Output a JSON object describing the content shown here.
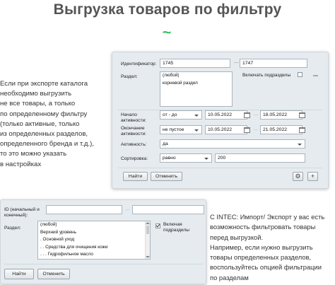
{
  "heading": "Выгрузка товаров по фильтру",
  "decor": "~",
  "left_text": "Если при экспорте каталога\nнеобходимо выгрузить\nне все товары, а только\nпо определенному фильтру\n(только активные, только\nиз определенных разделов,\nопределенного бренда и т.д.),\nто это можно указать\nв настройках",
  "right_text": "С INTEC: Импорт/ Экспорт у вас есть\nвозможность фильтровать товары\nперед выгрузкой.\nНапример, если нужно выгрузить\nтовары определенных разделов,\nвоспользуйтесь опцией фильтрации\nпо разделам",
  "filter_panel": {
    "id_label": "Идентификатор:",
    "id_from": "1745",
    "id_to": "1747",
    "section_label": "Раздел:",
    "section_options": [
      "(любой)",
      "корневой раздел"
    ],
    "include_subsections_label": "Включать подразделы",
    "start_label": "Начало активности:",
    "start_operator": "от - до",
    "start_from": "10.05.2022",
    "start_to": "18.05.2022",
    "end_label": "Окончание активности:",
    "end_operator": "не пустое",
    "end_from": "10.05.2022",
    "end_to": "21.05.2022",
    "active_label": "Активность:",
    "active_value": "да",
    "sort_label": "Сортировка:",
    "sort_operator": "равно",
    "sort_value": "200",
    "find_button": "Найти",
    "cancel_button": "Отменить",
    "settings_icon": "gear-icon",
    "add_icon": "plus-icon",
    "add_symbol": "+",
    "settings_symbol": "⚙"
  },
  "small_panel": {
    "id_label": "ID (начальный и конечный):",
    "id_from": "",
    "id_to": "",
    "section_label": "Раздел:",
    "section_options": [
      "(любой)",
      "Верхний уровень",
      ". Основной уход",
      ". . Средства для очищения кожи",
      ". . . Гидрофильное масло"
    ],
    "include_subsections_label": "Включая подразделы",
    "include_subsections_checked": true,
    "find_button": "Найти",
    "cancel_button": "Отменить"
  }
}
